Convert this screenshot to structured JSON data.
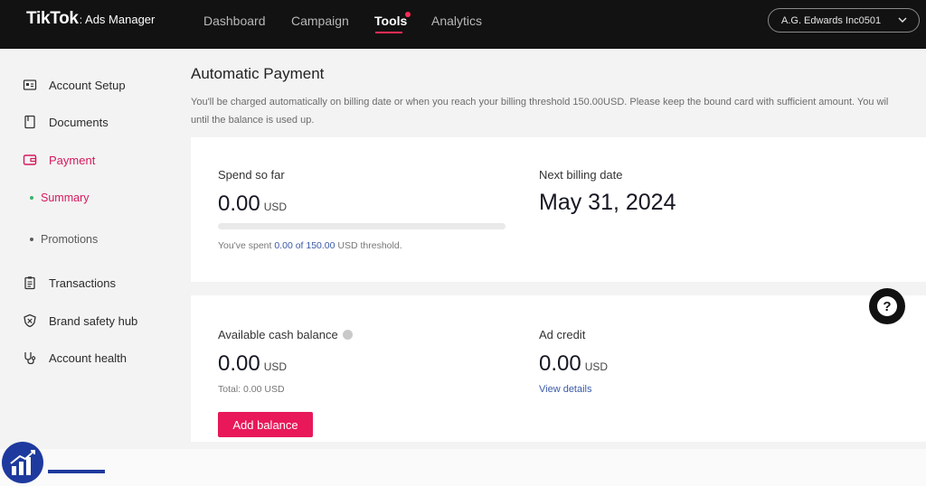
{
  "header": {
    "brand_main": "TikTok",
    "brand_sep": ":",
    "brand_sub": "Ads Manager",
    "nav": [
      {
        "label": "Dashboard"
      },
      {
        "label": "Campaign"
      },
      {
        "label": "Tools",
        "active": true
      },
      {
        "label": "Analytics"
      }
    ],
    "account_name": "A.G. Edwards Inc0501"
  },
  "sidebar": {
    "items": [
      {
        "label": "Account Setup",
        "icon": "id-card-icon"
      },
      {
        "label": "Documents",
        "icon": "document-icon"
      },
      {
        "label": "Payment",
        "icon": "wallet-icon",
        "active": true
      },
      {
        "label": "Transactions",
        "icon": "clipboard-icon"
      },
      {
        "label": "Brand safety hub",
        "icon": "shield-icon"
      },
      {
        "label": "Account health",
        "icon": "stethoscope-icon"
      }
    ],
    "sub_items": [
      {
        "label": "Summary",
        "active": true
      },
      {
        "label": "Promotions"
      }
    ]
  },
  "main": {
    "title": "Automatic Payment",
    "description_line1": "You'll be charged automatically on billing date or when you reach your billing threshold 150.00USD. Please keep the bound card with sufficient amount. You wil",
    "description_line2": "until the balance is used up.",
    "spend": {
      "label": "Spend so far",
      "amount": "0.00",
      "unit": "USD",
      "progress_fraction": 0,
      "note_prefix": "You've spent ",
      "note_amount": "0.00 of 150.00",
      "note_suffix": " USD threshold."
    },
    "billing": {
      "label": "Next billing date",
      "date": "May 31, 2024"
    },
    "cash": {
      "label": "Available cash balance",
      "amount": "0.00",
      "unit": "USD",
      "total": "Total: 0.00 USD",
      "button": "Add balance"
    },
    "credit": {
      "label": "Ad credit",
      "amount": "0.00",
      "unit": "USD",
      "link": "View details"
    }
  },
  "help_label": "?",
  "colors": {
    "topbar": "#121212",
    "accent": "#fe2c55",
    "active_text": "#d6195c",
    "button": "#e8185a",
    "link": "#3a5aa8"
  }
}
